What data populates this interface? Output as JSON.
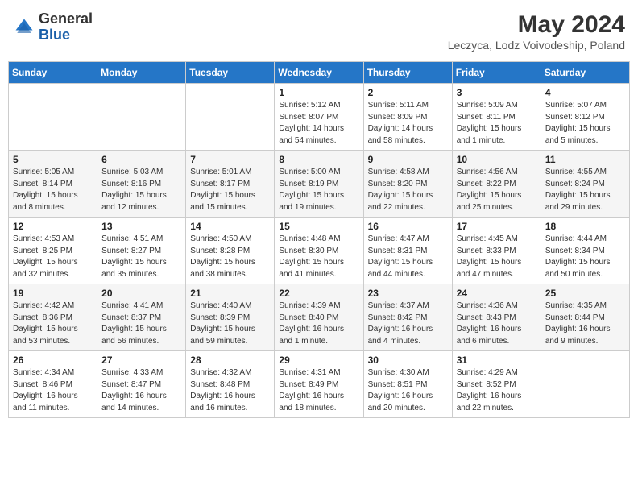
{
  "header": {
    "logo_general": "General",
    "logo_blue": "Blue",
    "main_title": "May 2024",
    "subtitle": "Leczyca, Lodz Voivodeship, Poland"
  },
  "weekdays": [
    "Sunday",
    "Monday",
    "Tuesday",
    "Wednesday",
    "Thursday",
    "Friday",
    "Saturday"
  ],
  "weeks": [
    [
      {
        "day": "",
        "info": ""
      },
      {
        "day": "",
        "info": ""
      },
      {
        "day": "",
        "info": ""
      },
      {
        "day": "1",
        "info": "Sunrise: 5:12 AM\nSunset: 8:07 PM\nDaylight: 14 hours\nand 54 minutes."
      },
      {
        "day": "2",
        "info": "Sunrise: 5:11 AM\nSunset: 8:09 PM\nDaylight: 14 hours\nand 58 minutes."
      },
      {
        "day": "3",
        "info": "Sunrise: 5:09 AM\nSunset: 8:11 PM\nDaylight: 15 hours\nand 1 minute."
      },
      {
        "day": "4",
        "info": "Sunrise: 5:07 AM\nSunset: 8:12 PM\nDaylight: 15 hours\nand 5 minutes."
      }
    ],
    [
      {
        "day": "5",
        "info": "Sunrise: 5:05 AM\nSunset: 8:14 PM\nDaylight: 15 hours\nand 8 minutes."
      },
      {
        "day": "6",
        "info": "Sunrise: 5:03 AM\nSunset: 8:16 PM\nDaylight: 15 hours\nand 12 minutes."
      },
      {
        "day": "7",
        "info": "Sunrise: 5:01 AM\nSunset: 8:17 PM\nDaylight: 15 hours\nand 15 minutes."
      },
      {
        "day": "8",
        "info": "Sunrise: 5:00 AM\nSunset: 8:19 PM\nDaylight: 15 hours\nand 19 minutes."
      },
      {
        "day": "9",
        "info": "Sunrise: 4:58 AM\nSunset: 8:20 PM\nDaylight: 15 hours\nand 22 minutes."
      },
      {
        "day": "10",
        "info": "Sunrise: 4:56 AM\nSunset: 8:22 PM\nDaylight: 15 hours\nand 25 minutes."
      },
      {
        "day": "11",
        "info": "Sunrise: 4:55 AM\nSunset: 8:24 PM\nDaylight: 15 hours\nand 29 minutes."
      }
    ],
    [
      {
        "day": "12",
        "info": "Sunrise: 4:53 AM\nSunset: 8:25 PM\nDaylight: 15 hours\nand 32 minutes."
      },
      {
        "day": "13",
        "info": "Sunrise: 4:51 AM\nSunset: 8:27 PM\nDaylight: 15 hours\nand 35 minutes."
      },
      {
        "day": "14",
        "info": "Sunrise: 4:50 AM\nSunset: 8:28 PM\nDaylight: 15 hours\nand 38 minutes."
      },
      {
        "day": "15",
        "info": "Sunrise: 4:48 AM\nSunset: 8:30 PM\nDaylight: 15 hours\nand 41 minutes."
      },
      {
        "day": "16",
        "info": "Sunrise: 4:47 AM\nSunset: 8:31 PM\nDaylight: 15 hours\nand 44 minutes."
      },
      {
        "day": "17",
        "info": "Sunrise: 4:45 AM\nSunset: 8:33 PM\nDaylight: 15 hours\nand 47 minutes."
      },
      {
        "day": "18",
        "info": "Sunrise: 4:44 AM\nSunset: 8:34 PM\nDaylight: 15 hours\nand 50 minutes."
      }
    ],
    [
      {
        "day": "19",
        "info": "Sunrise: 4:42 AM\nSunset: 8:36 PM\nDaylight: 15 hours\nand 53 minutes."
      },
      {
        "day": "20",
        "info": "Sunrise: 4:41 AM\nSunset: 8:37 PM\nDaylight: 15 hours\nand 56 minutes."
      },
      {
        "day": "21",
        "info": "Sunrise: 4:40 AM\nSunset: 8:39 PM\nDaylight: 15 hours\nand 59 minutes."
      },
      {
        "day": "22",
        "info": "Sunrise: 4:39 AM\nSunset: 8:40 PM\nDaylight: 16 hours\nand 1 minute."
      },
      {
        "day": "23",
        "info": "Sunrise: 4:37 AM\nSunset: 8:42 PM\nDaylight: 16 hours\nand 4 minutes."
      },
      {
        "day": "24",
        "info": "Sunrise: 4:36 AM\nSunset: 8:43 PM\nDaylight: 16 hours\nand 6 minutes."
      },
      {
        "day": "25",
        "info": "Sunrise: 4:35 AM\nSunset: 8:44 PM\nDaylight: 16 hours\nand 9 minutes."
      }
    ],
    [
      {
        "day": "26",
        "info": "Sunrise: 4:34 AM\nSunset: 8:46 PM\nDaylight: 16 hours\nand 11 minutes."
      },
      {
        "day": "27",
        "info": "Sunrise: 4:33 AM\nSunset: 8:47 PM\nDaylight: 16 hours\nand 14 minutes."
      },
      {
        "day": "28",
        "info": "Sunrise: 4:32 AM\nSunset: 8:48 PM\nDaylight: 16 hours\nand 16 minutes."
      },
      {
        "day": "29",
        "info": "Sunrise: 4:31 AM\nSunset: 8:49 PM\nDaylight: 16 hours\nand 18 minutes."
      },
      {
        "day": "30",
        "info": "Sunrise: 4:30 AM\nSunset: 8:51 PM\nDaylight: 16 hours\nand 20 minutes."
      },
      {
        "day": "31",
        "info": "Sunrise: 4:29 AM\nSunset: 8:52 PM\nDaylight: 16 hours\nand 22 minutes."
      },
      {
        "day": "",
        "info": ""
      }
    ]
  ]
}
